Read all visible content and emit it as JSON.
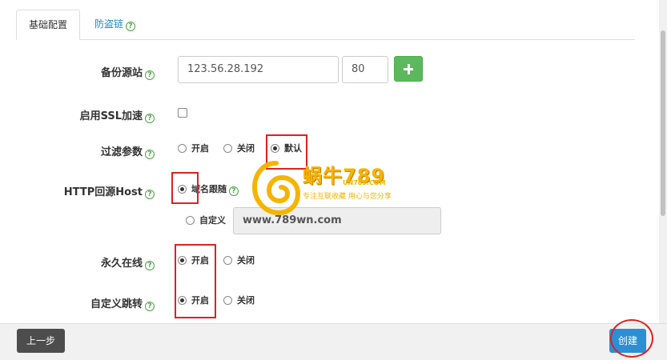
{
  "tabs": [
    {
      "label": "基础配置",
      "active": true
    },
    {
      "label": "防盗链",
      "active": false
    }
  ],
  "form": {
    "backup_source": {
      "label": "备份源站",
      "ip_value": "123.56.28.192",
      "port_value": "80"
    },
    "ssl": {
      "label": "启用SSL加速",
      "checked": false
    },
    "filter_params": {
      "label": "过滤参数",
      "options": [
        "开启",
        "关闭",
        "默认"
      ],
      "selected": "默认"
    },
    "http_host": {
      "label": "HTTP回源Host",
      "option_follow": "域名跟随",
      "option_custom": "自定义",
      "custom_value": "www.789wn.com",
      "selected": "域名跟随"
    },
    "always_online": {
      "label": "永久在线",
      "options": [
        "开启",
        "关闭"
      ],
      "selected": "开启"
    },
    "custom_redirect": {
      "label": "自定义跳转",
      "options": [
        "开启",
        "关闭"
      ],
      "selected": "开启"
    }
  },
  "footer": {
    "prev_label": "上一步",
    "create_label": "创建"
  },
  "watermark": {
    "title": "蜗牛789",
    "sub": "UN789.COM",
    "slogan": "专注互联收藏 用心与您分享"
  },
  "colors": {
    "accent": "#2b8fd5",
    "plus_green": "#5cb85c",
    "help_green": "#4aa745",
    "annotation_red": "#e02020",
    "link_blue": "#1e88c9"
  },
  "icons": {
    "help": "question-circle-icon",
    "add": "plus-icon"
  }
}
